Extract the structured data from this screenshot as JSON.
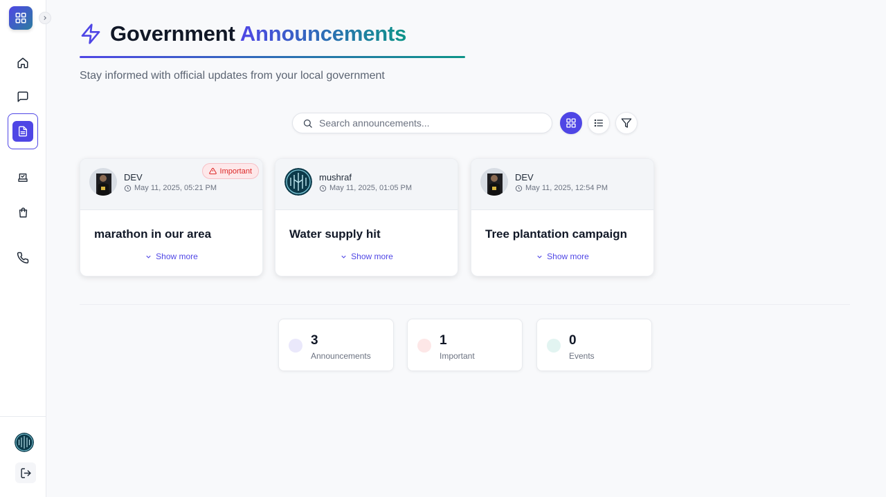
{
  "header": {
    "title_main": "Government",
    "title_accent": "Announcements",
    "subtitle": "Stay informed with official updates from your local government"
  },
  "search": {
    "placeholder": "Search announcements..."
  },
  "view_controls": {
    "grid_icon": "grid-icon",
    "list_icon": "list-icon",
    "filter_icon": "filter-icon"
  },
  "sidebar": {
    "items": [
      {
        "icon": "home-icon"
      },
      {
        "icon": "message-icon"
      },
      {
        "icon": "document-icon",
        "active": true
      },
      {
        "icon": "vote-box-icon"
      },
      {
        "icon": "shopping-bag-icon"
      },
      {
        "icon": "phone-icon"
      }
    ],
    "bottom": {
      "avatar": "user-avatar",
      "logout_icon": "logout-icon"
    }
  },
  "announcements": [
    {
      "author": "DEV",
      "date": "May 11, 2025, 05:21 PM",
      "title": "marathon in our area",
      "important": true,
      "badge": "Important",
      "show_more": "Show more"
    },
    {
      "author": "mushraf",
      "date": "May 11, 2025, 01:05 PM",
      "title": "Water supply hit",
      "important": false,
      "show_more": "Show more"
    },
    {
      "author": "DEV",
      "date": "May 11, 2025, 12:54 PM",
      "title": "Tree plantation campaign",
      "important": false,
      "show_more": "Show more"
    }
  ],
  "stats": [
    {
      "value": "3",
      "label": "Announcements",
      "color": "#eae8fb"
    },
    {
      "value": "1",
      "label": "Important",
      "color": "#fde7e7"
    },
    {
      "value": "0",
      "label": "Events",
      "color": "#e2f4f1"
    }
  ],
  "colors": {
    "accent": "#4f46e5",
    "accent_end": "#0d9488",
    "danger": "#dc2626"
  }
}
